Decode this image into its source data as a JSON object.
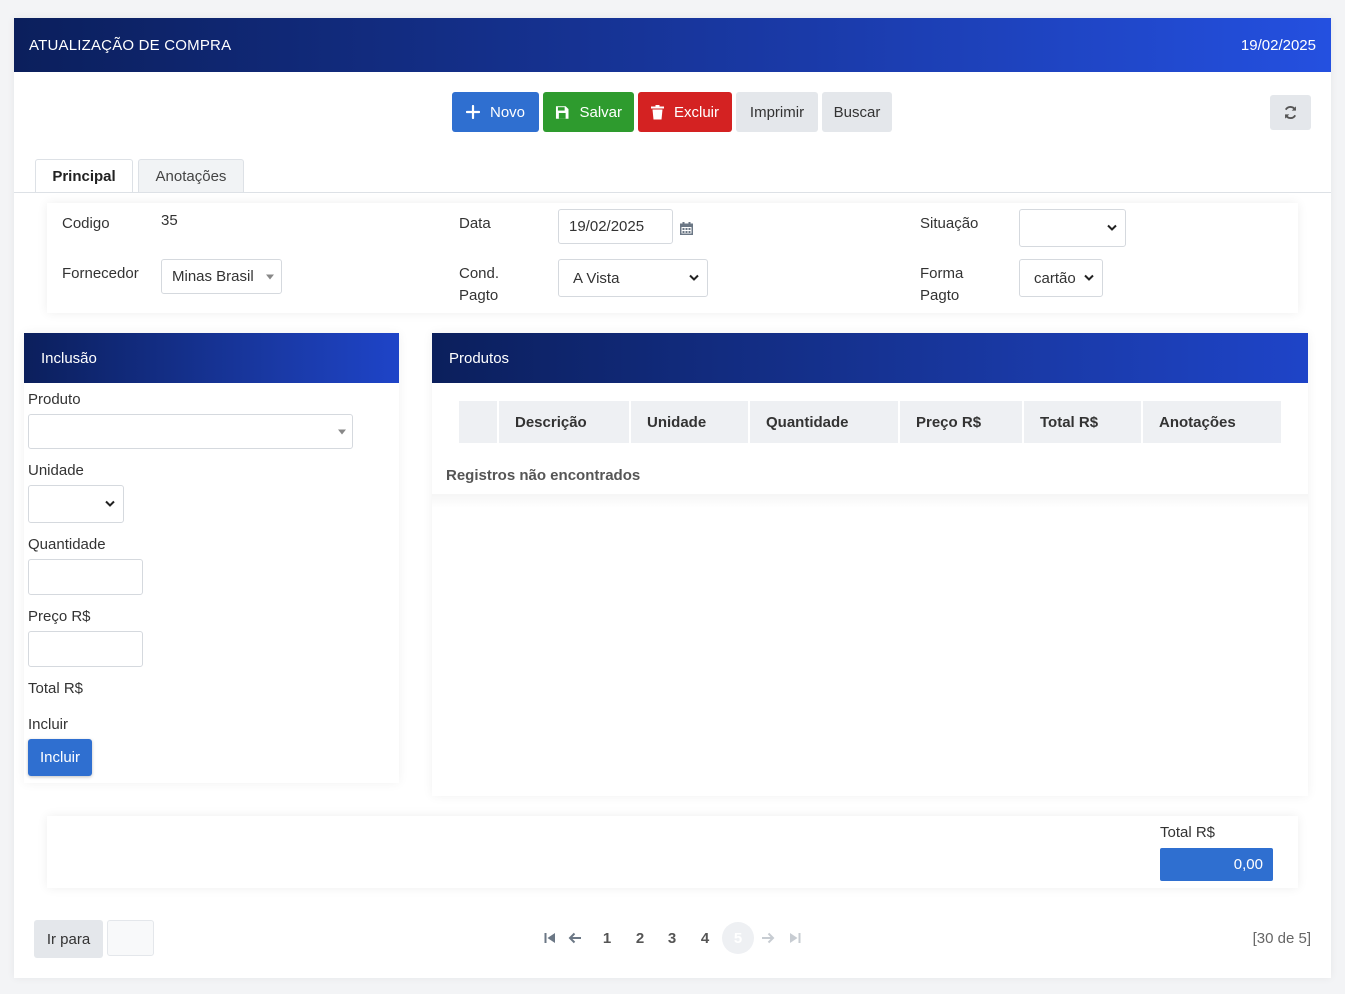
{
  "header": {
    "title": "ATUALIZAÇÃO DE COMPRA",
    "date": "19/02/2025"
  },
  "toolbar": {
    "novo": "Novo",
    "salvar": "Salvar",
    "excluir": "Excluir",
    "imprimir": "Imprimir",
    "buscar": "Buscar",
    "refresh_icon": "refresh-icon"
  },
  "tabs": [
    {
      "label": "Principal",
      "active": true
    },
    {
      "label": "Anotações",
      "active": false
    }
  ],
  "form": {
    "codigo_label": "Codigo",
    "codigo_value": "35",
    "data_label": "Data",
    "data_value": "19/02/2025",
    "situacao_label": "Situação",
    "situacao_value": "",
    "fornecedor_label": "Fornecedor",
    "fornecedor_value": "Minas Brasil",
    "condpagto_label_1": "Cond.",
    "condpagto_label_2": "Pagto",
    "condpagto_value": "A Vista",
    "formapagto_label_1": "Forma",
    "formapagto_label_2": "Pagto",
    "formapagto_value": "cartão"
  },
  "inclusao": {
    "title": "Inclusão",
    "produto_label": "Produto",
    "produto_value": "",
    "unidade_label": "Unidade",
    "unidade_value": "",
    "quantidade_label": "Quantidade",
    "quantidade_value": "",
    "preco_label": "Preço R$",
    "preco_value": "",
    "total_label": "Total R$",
    "incluir_label": "Incluir",
    "incluir_button": "Incluir"
  },
  "produtos": {
    "title": "Produtos",
    "columns": [
      "",
      "Descrição",
      "Unidade",
      "Quantidade",
      "Preço R$",
      "Total R$",
      "Anotações"
    ],
    "empty_message": "Registros não encontrados"
  },
  "totals": {
    "label": "Total R$",
    "value": "0,00"
  },
  "pagination": {
    "goto_label": "Ir para",
    "goto_value": "",
    "pages": [
      "1",
      "2",
      "3",
      "4",
      "5"
    ],
    "active_page": "5",
    "summary": "[30 de 5]"
  },
  "colors": {
    "primary": "#2f6fd0",
    "success": "#2e9b2e",
    "danger": "#d42222",
    "header_dark": "#0b1f5c"
  }
}
